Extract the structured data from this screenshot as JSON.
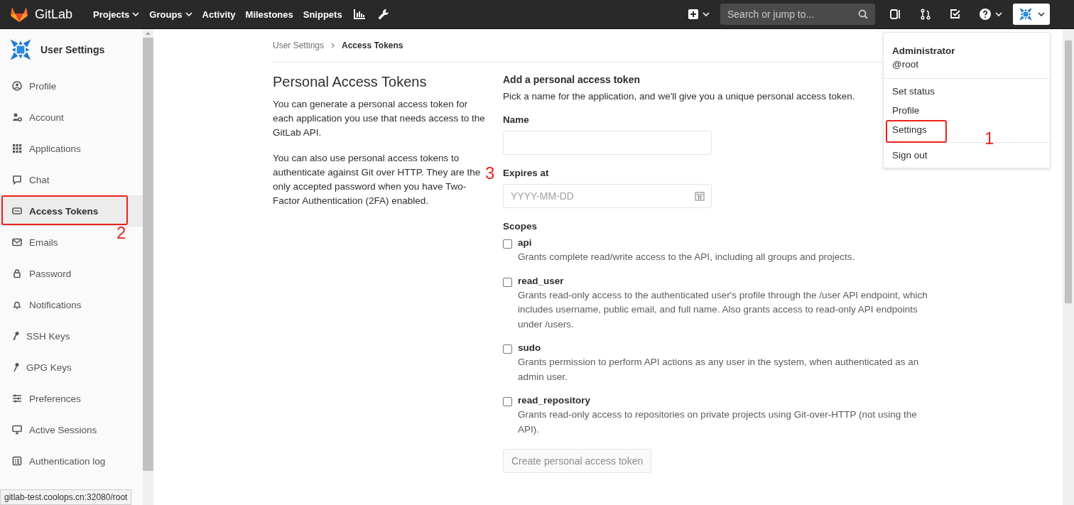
{
  "topbar": {
    "brand": "GitLab",
    "nav": [
      {
        "label": "Projects",
        "dropdown": true
      },
      {
        "label": "Groups",
        "dropdown": true
      },
      {
        "label": "Activity",
        "dropdown": false
      },
      {
        "label": "Milestones",
        "dropdown": false
      },
      {
        "label": "Snippets",
        "dropdown": false
      }
    ],
    "search": {
      "placeholder": "Search or jump to..."
    }
  },
  "sidebar": {
    "title": "User Settings",
    "items": [
      {
        "label": "Profile",
        "selected": false
      },
      {
        "label": "Account",
        "selected": false
      },
      {
        "label": "Applications",
        "selected": false
      },
      {
        "label": "Chat",
        "selected": false
      },
      {
        "label": "Access Tokens",
        "selected": true,
        "annotation": "2"
      },
      {
        "label": "Emails",
        "selected": false
      },
      {
        "label": "Password",
        "selected": false
      },
      {
        "label": "Notifications",
        "selected": false
      },
      {
        "label": "SSH Keys",
        "selected": false
      },
      {
        "label": "GPG Keys",
        "selected": false
      },
      {
        "label": "Preferences",
        "selected": false
      },
      {
        "label": "Active Sessions",
        "selected": false
      },
      {
        "label": "Authentication log",
        "selected": false
      }
    ]
  },
  "breadcrumb": [
    {
      "label": "User Settings"
    },
    {
      "label": "Access Tokens"
    }
  ],
  "intro": {
    "title": "Personal Access Tokens",
    "paragraphs": [
      "You can generate a personal access token for each application you use that needs access to the GitLab API.",
      "You can also use personal access tokens to authenticate against Git over HTTP. They are the only accepted password when you have Two-Factor Authentication (2FA) enabled."
    ]
  },
  "form": {
    "title": "Add a personal access token",
    "subtitle": "Pick a name for the application, and we'll give you a unique personal access token.",
    "name_label": "Name",
    "annotation": "3",
    "expires_label": "Expires at",
    "expires_placeholder": "YYYY-MM-DD",
    "scopes_label": "Scopes",
    "scopes": [
      {
        "name": "api",
        "checked": false,
        "description": "Grants complete read/write access to the API, including all groups and projects."
      },
      {
        "name": "read_user",
        "checked": false,
        "description": "Grants read-only access to the authenticated user's profile through the /user API endpoint, which includes username, public email, and full name. Also grants access to read-only API endpoints under /users."
      },
      {
        "name": "sudo",
        "checked": false,
        "description": "Grants permission to perform API actions as any user in the system, when authenticated as an admin user."
      },
      {
        "name": "read_repository",
        "checked": false,
        "description": "Grants read-only access to repositories on private projects using Git-over-HTTP (not using the API)."
      }
    ],
    "submit": "Create personal access token"
  },
  "user_menu": {
    "name": "Administrator",
    "handle": "@root",
    "items": [
      {
        "label": "Set status"
      },
      {
        "label": "Profile"
      },
      {
        "label": "Settings",
        "annotation": "1"
      }
    ],
    "footer_items": [
      {
        "label": "Sign out"
      }
    ]
  },
  "status_url": "gitlab-test.coolops.cn:32080/root"
}
